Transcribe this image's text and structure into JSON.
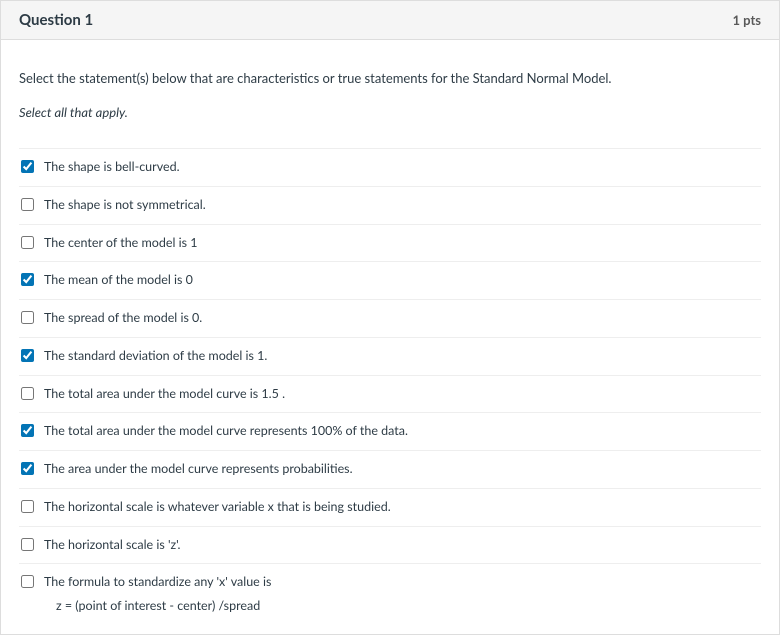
{
  "header": {
    "title": "Question 1",
    "points": "1 pts"
  },
  "prompt": {
    "main": "Select the statement(s) below that are characteristics or true statements for the Standard Normal Model.",
    "sub": "Select all that apply."
  },
  "answers": [
    {
      "label": "The shape is bell-curved.",
      "checked": true
    },
    {
      "label": "The shape is not symmetrical.",
      "checked": false
    },
    {
      "label": "The center of the model is 1",
      "checked": false
    },
    {
      "label": "The mean of the model is 0",
      "checked": true
    },
    {
      "label": "The spread of the model is 0.",
      "checked": false
    },
    {
      "label": "The standard deviation of the model is 1.",
      "checked": true
    },
    {
      "label": "The total area under the model curve is 1.5 .",
      "checked": false
    },
    {
      "label": "The total area under the model curve represents 100% of the data.",
      "checked": true
    },
    {
      "label": "The area under the model curve represents probabilities.",
      "checked": true
    },
    {
      "label": "The horizontal scale is whatever variable x that is being studied.",
      "checked": false
    },
    {
      "label": "The horizontal scale is 'z'.",
      "checked": false
    },
    {
      "label": "The formula to standardize any 'x' value is",
      "checked": false,
      "sub": "z = (point of interest - center) /spread"
    }
  ]
}
